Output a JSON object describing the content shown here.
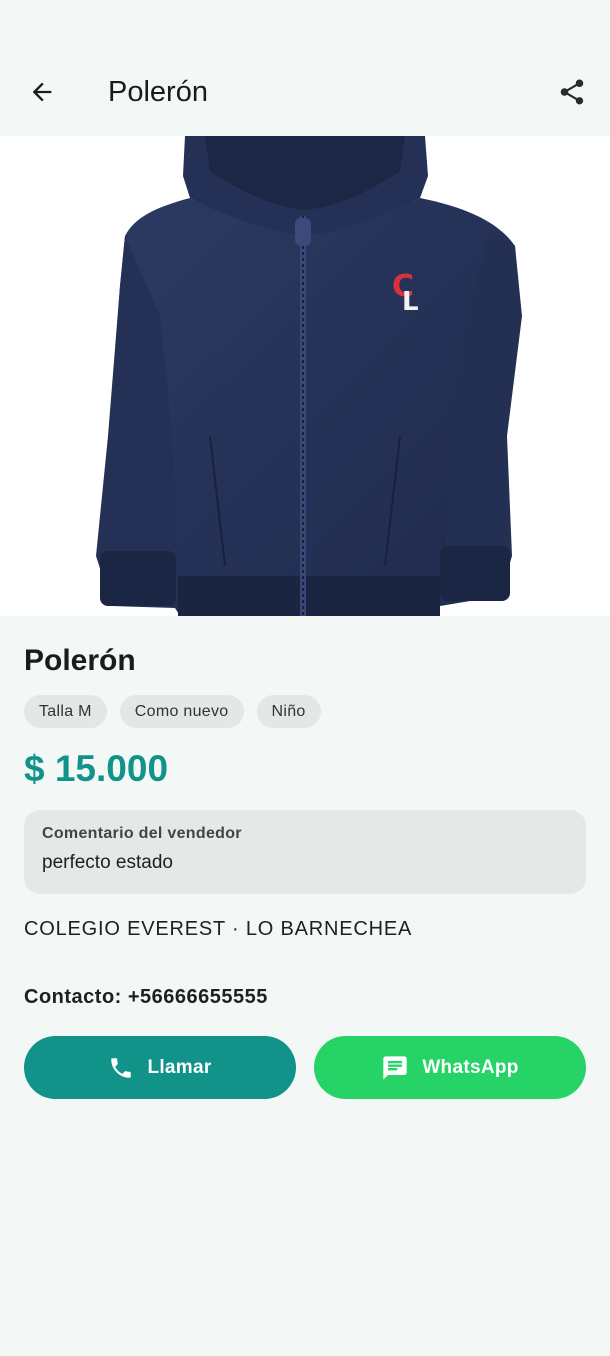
{
  "appbar": {
    "title": "Polerón",
    "back_icon": "arrow-back-icon",
    "share_icon": "share-icon"
  },
  "product": {
    "name": "Polerón",
    "image_alt": "navy hoodie",
    "tags": [
      "Talla M",
      "Como nuevo",
      "Niño"
    ],
    "price": "$ 15.000",
    "comment_label": "Comentario del vendedor",
    "comment_text": "perfecto estado",
    "school": "COLEGIO EVEREST · LO BARNECHEA",
    "contact": "Contacto: +56666655555"
  },
  "actions": {
    "call_label": "Llamar",
    "whatsapp_label": "WhatsApp"
  },
  "colors": {
    "accent": "#12938a",
    "whatsapp": "#26d366",
    "background": "#f3f8f7"
  }
}
